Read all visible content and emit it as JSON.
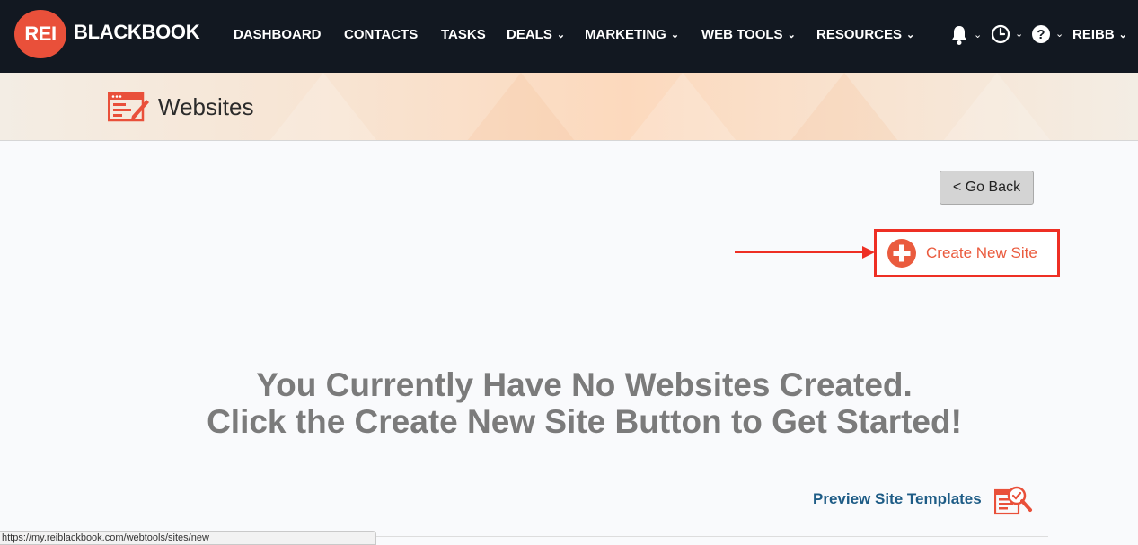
{
  "brand": {
    "logo_mark": "REI",
    "logo_text": "BLACKBOOK",
    "accent": "#e9503a"
  },
  "nav": {
    "items": [
      {
        "label": "DASHBOARD",
        "dropdown": false
      },
      {
        "label": "CONTACTS",
        "dropdown": false
      },
      {
        "label": "TASKS",
        "dropdown": false
      },
      {
        "label": "DEALS",
        "dropdown": true
      },
      {
        "label": "MARKETING",
        "dropdown": true
      },
      {
        "label": "WEB TOOLS",
        "dropdown": true
      },
      {
        "label": "RESOURCES",
        "dropdown": true
      }
    ],
    "icons": [
      "bell-icon",
      "clock-icon",
      "help-icon"
    ],
    "user": "REIBB"
  },
  "page": {
    "title": "Websites",
    "title_icon": "website-edit-icon"
  },
  "actions": {
    "go_back": "< Go Back",
    "create_new_site": "Create New Site"
  },
  "empty_state": {
    "line1": "You Currently Have No Websites Created.",
    "line2": "Click the Create New Site Button to Get Started!"
  },
  "templates": {
    "preview_link": "Preview Site Templates"
  },
  "status_bar": {
    "url": "https://my.reiblackbook.com/webtools/sites/new"
  },
  "colors": {
    "nav_bg": "#121821",
    "highlight_red": "#ee2f24",
    "link_blue": "#1e5c86",
    "message_gray": "#7b7b7b"
  }
}
